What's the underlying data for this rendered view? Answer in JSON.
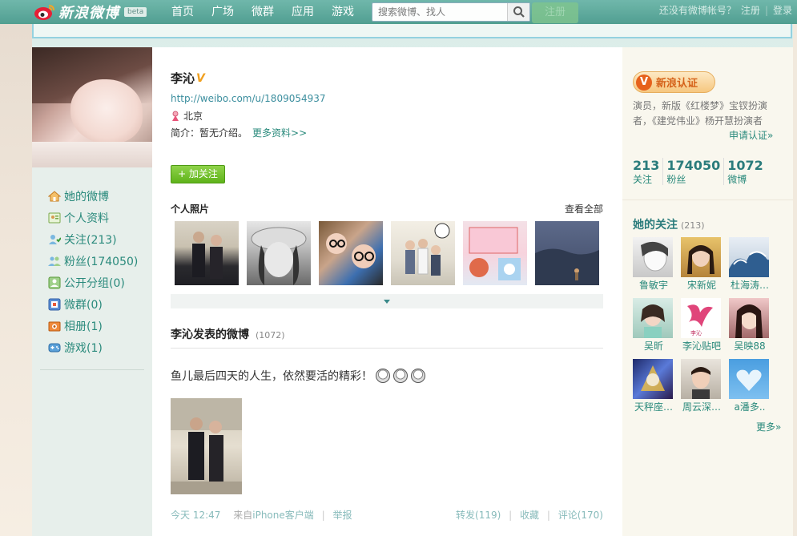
{
  "topbar": {
    "logo_text": "新浪微博",
    "beta": "beta",
    "nav": [
      "首页",
      "广场",
      "微群",
      "应用",
      "游戏"
    ],
    "search_placeholder": "搜索微博、找人",
    "ghost_button": "注册",
    "no_account": "还没有微博帐号？",
    "register": "注册",
    "login": "登录",
    "colors": {
      "bar": "#4a9b8d",
      "text": "#ffffff"
    }
  },
  "sidebar": {
    "items": [
      {
        "label": "她的微博",
        "icon": "home-icon"
      },
      {
        "label": "个人资料",
        "icon": "profile-card-icon"
      },
      {
        "label": "关注(213)",
        "icon": "follow-user-icon"
      },
      {
        "label": "粉丝(174050)",
        "icon": "fans-icon"
      },
      {
        "label": "公开分组(0)",
        "icon": "group-icon"
      },
      {
        "label": "微群(0)",
        "icon": "weiqun-icon"
      },
      {
        "label": "相册(1)",
        "icon": "album-icon"
      },
      {
        "label": "游戏(1)",
        "icon": "game-icon"
      }
    ]
  },
  "profile": {
    "name": "李沁",
    "verified_mark": "V",
    "url": "http://weibo.com/u/1809054937",
    "location": "北京",
    "bio": "简介：暂无介绍。",
    "more_info": "更多资料>>",
    "follow_button": "+ 加关注"
  },
  "photos": {
    "title": "个人照片",
    "view_all": "查看全部"
  },
  "posts": {
    "title": "李沁发表的微博",
    "count": "(1072)",
    "items": [
      {
        "text": "鱼儿最后四天的人生，依然要活的精彩！",
        "time": "今天 12:47",
        "source_prefix": "来自",
        "source": "iPhone客户端",
        "report": "举报",
        "repost": "转发(119)",
        "favorite": "收藏",
        "comment": "评论(170)"
      }
    ]
  },
  "verification": {
    "badge": "新浪认证",
    "desc": "演员，新版《红楼梦》宝钗扮演者，《建党伟业》杨开慧扮演者",
    "apply": "申请认证»"
  },
  "stats": [
    {
      "num": "213",
      "label": "关注"
    },
    {
      "num": "174050",
      "label": "粉丝"
    },
    {
      "num": "1072",
      "label": "微博"
    }
  ],
  "following": {
    "title": "她的关注",
    "count": "(213)",
    "people": [
      "鲁敏宇",
      "宋新妮",
      "杜海涛…",
      "吴昕",
      "李沁贴吧",
      "吴映88",
      "天秤座…",
      "周云深…",
      "a潘多.."
    ],
    "more": "更多»"
  }
}
